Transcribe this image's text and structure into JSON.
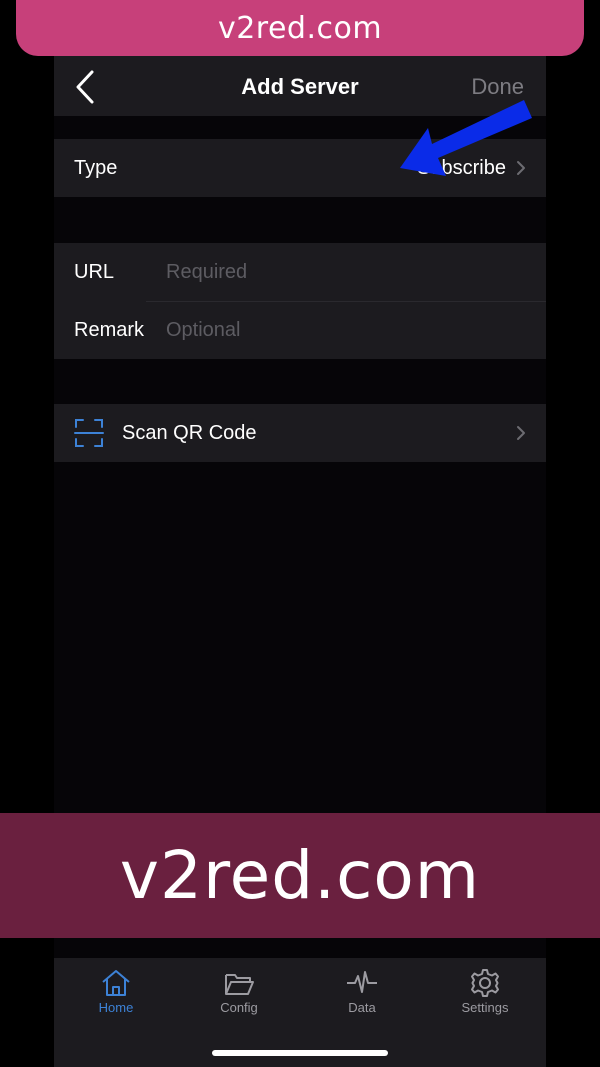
{
  "watermark": {
    "top": "v2red.com",
    "bottom": "v2red.com"
  },
  "navbar": {
    "title": "Add Server",
    "done_label": "Done"
  },
  "type_row": {
    "label": "Type",
    "value": "Subscribe"
  },
  "form": {
    "url": {
      "label": "URL",
      "placeholder": "Required",
      "value": ""
    },
    "remark": {
      "label": "Remark",
      "placeholder": "Optional",
      "value": ""
    }
  },
  "scan": {
    "label": "Scan QR Code",
    "icon": "qr-scan-icon"
  },
  "tabs": [
    {
      "label": "Home",
      "icon": "home-icon",
      "active": true
    },
    {
      "label": "Config",
      "icon": "folder-icon",
      "active": false
    },
    {
      "label": "Data",
      "icon": "pulse-icon",
      "active": false
    },
    {
      "label": "Settings",
      "icon": "gear-icon",
      "active": false
    }
  ],
  "colors": {
    "accent": "#3d82d6",
    "annotation_arrow": "#0a2be8",
    "watermark_top": "#c7407a",
    "watermark_bottom": "#6a203f"
  }
}
